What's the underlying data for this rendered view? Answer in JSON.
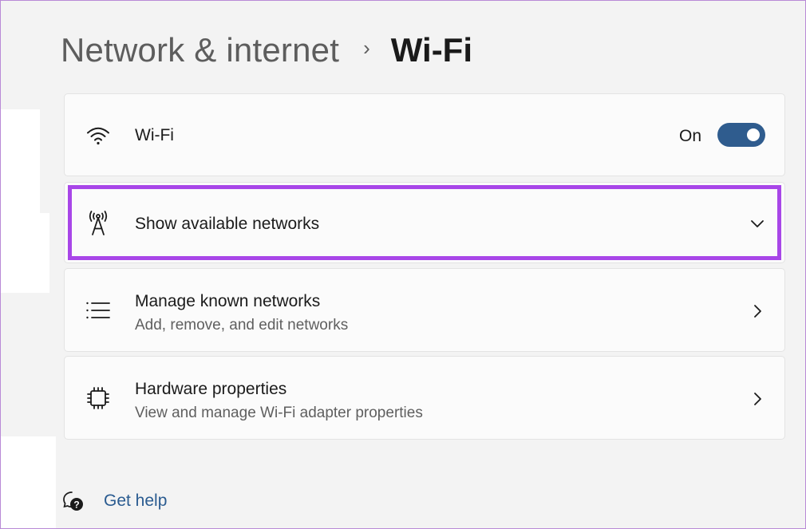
{
  "breadcrumb": {
    "parent": "Network & internet",
    "separator": "›",
    "current": "Wi-Fi"
  },
  "wifi_card": {
    "icon": "wifi-icon",
    "title": "Wi-Fi",
    "toggle_label": "On",
    "toggle_on": true
  },
  "show_networks_card": {
    "icon": "antenna-icon",
    "title": "Show available networks",
    "expand_icon": "chevron-down-icon",
    "highlighted": true
  },
  "manage_card": {
    "icon": "list-icon",
    "title": "Manage known networks",
    "subtitle": "Add, remove, and edit networks",
    "nav_icon": "chevron-right-icon"
  },
  "hardware_card": {
    "icon": "chip-icon",
    "title": "Hardware properties",
    "subtitle": "View and manage Wi-Fi adapter properties",
    "nav_icon": "chevron-right-icon"
  },
  "help": {
    "icon": "help-icon",
    "label": "Get help"
  },
  "colors": {
    "accent": "#2f5c8e",
    "highlight": "#a846e8",
    "link": "#2a5b90",
    "background": "#f3f3f3",
    "card": "#fbfbfb"
  }
}
